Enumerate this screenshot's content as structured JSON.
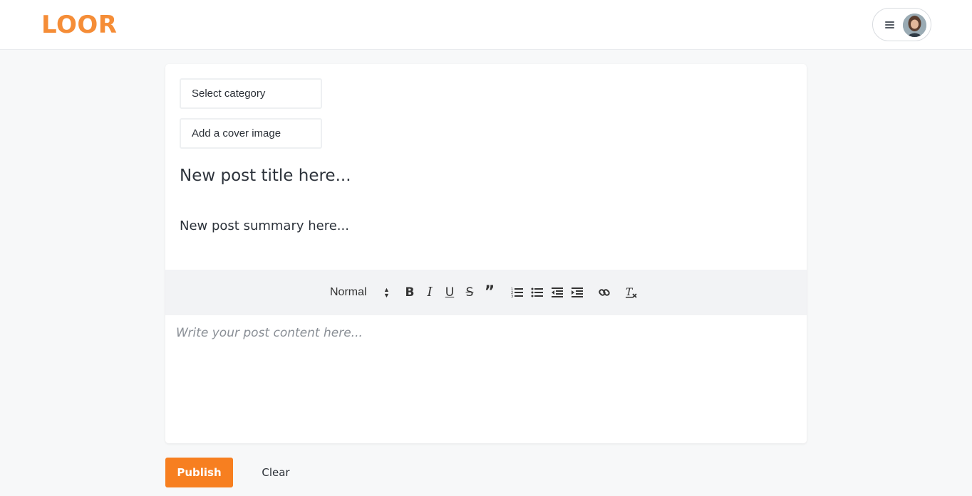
{
  "header": {
    "logo": "LOOR",
    "menu_icon": "hamburger-icon",
    "avatar_icon": "user-avatar"
  },
  "form": {
    "category_label": "Select category",
    "cover_label": "Add a cover image",
    "title_placeholder": "New post title here...",
    "summary_placeholder": "New post summary here..."
  },
  "toolbar": {
    "heading_select": "Normal",
    "buttons": [
      "bold-icon",
      "italic-icon",
      "underline-icon",
      "strikethrough-icon",
      "blockquote-icon",
      "ordered-list-icon",
      "bullet-list-icon",
      "outdent-icon",
      "indent-icon",
      "link-icon",
      "clear-format-icon"
    ]
  },
  "editor": {
    "placeholder": "Write your post content here..."
  },
  "actions": {
    "publish_label": "Publish",
    "clear_label": "Clear"
  },
  "colors": {
    "brand": "#f58d37",
    "publish_button": "#f77f20",
    "toolbar_bg": "#f2f3f5"
  }
}
